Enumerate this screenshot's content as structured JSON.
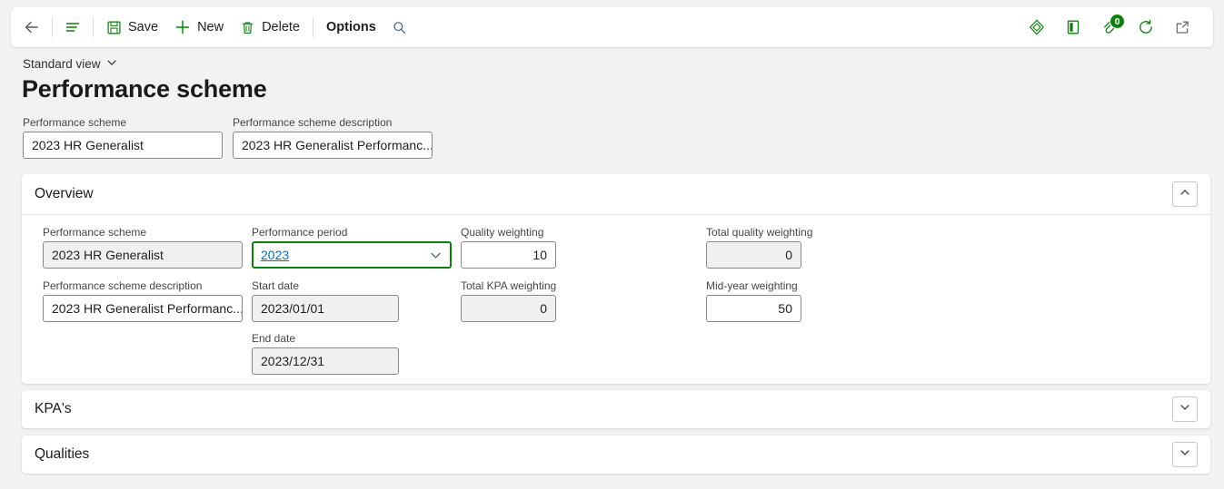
{
  "toolbar": {
    "back_label": "Back",
    "nav_label": "Show navigation",
    "save_label": "Save",
    "new_label": "New",
    "delete_label": "Delete",
    "options_label": "Options",
    "search_label": "Search",
    "office_label": "Open in Microsoft Office",
    "powerbi_label": "Power BI",
    "attachments_label": "Attachments",
    "attachments_count": "0",
    "refresh_label": "Refresh",
    "popout_label": "Open in new window"
  },
  "page": {
    "view_selector": "Standard view",
    "title": "Performance scheme"
  },
  "header_fields": [
    {
      "label": "Performance scheme",
      "value": "2023 HR Generalist",
      "name": "performance-scheme",
      "disabled": false
    },
    {
      "label": "Performance scheme description",
      "value": "2023 HR Generalist Performanc...",
      "name": "performance-scheme-description",
      "disabled": false
    }
  ],
  "sections": [
    {
      "name": "overview",
      "title": "Overview",
      "expanded": true,
      "toggle_icon": "chevron-up-icon"
    },
    {
      "name": "kpas",
      "title": "KPA's",
      "expanded": false,
      "toggle_icon": "chevron-down-icon"
    },
    {
      "name": "qualities",
      "title": "Qualities",
      "expanded": false,
      "toggle_icon": "chevron-down-icon"
    }
  ],
  "overview_fields": {
    "performance_scheme": {
      "label": "Performance scheme",
      "value": "2023 HR Generalist"
    },
    "performance_scheme_description": {
      "label": "Performance scheme description",
      "value": "2023 HR Generalist Performanc..."
    },
    "performance_period": {
      "label": "Performance period",
      "value": "2023"
    },
    "start_date": {
      "label": "Start date",
      "value": "2023/01/01"
    },
    "end_date": {
      "label": "End date",
      "value": "2023/12/31"
    },
    "quality_weighting": {
      "label": "Quality weighting",
      "value": "10"
    },
    "total_kpa_weighting": {
      "label": "Total KPA weighting",
      "value": "0"
    },
    "total_quality_weighting": {
      "label": "Total quality weighting",
      "value": "0"
    },
    "mid_year_weighting": {
      "label": "Mid-year weighting",
      "value": "50"
    }
  },
  "colors": {
    "accent_green": "#107c10",
    "link_blue": "#0f6cbd",
    "page_bg": "#f2f2f2",
    "disabled_field_bg": "#f0f0f0"
  }
}
